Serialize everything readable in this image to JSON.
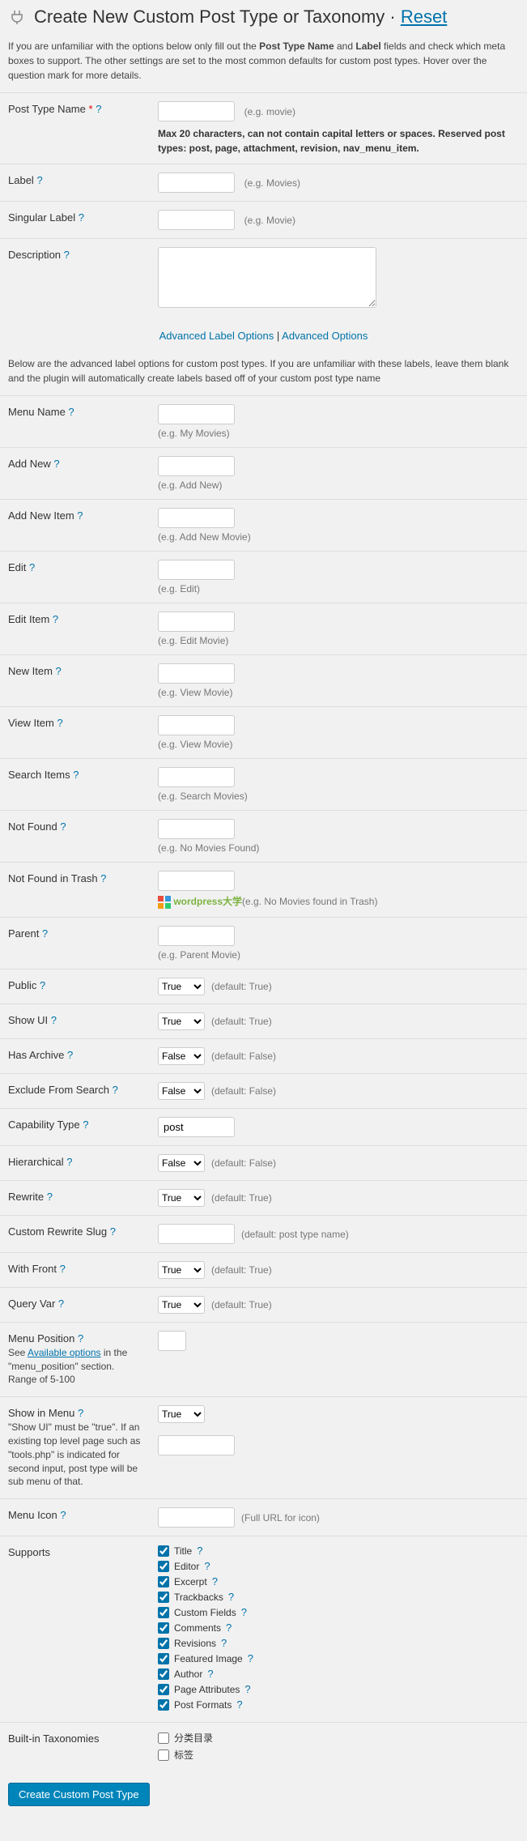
{
  "header": {
    "title": "Create New Custom Post Type or Taxonomy",
    "separator": " · ",
    "reset": "Reset"
  },
  "intro": {
    "prefix": "If you are unfamiliar with the options below only fill out the ",
    "b1": "Post Type Name",
    "mid": " and ",
    "b2": "Label",
    "suffix": " fields and check which meta boxes to support. The other settings are set to the most common defaults for custom post types. Hover over the question mark for more details."
  },
  "fields": {
    "post_type_name": {
      "label": "Post Type Name",
      "hint": "(e.g. movie)",
      "max_note": "Max 20 characters, can not contain capital letters or spaces. Reserved post types: post, page, attachment, revision, nav_menu_item."
    },
    "label": {
      "label": "Label",
      "hint": "(e.g. Movies)"
    },
    "singular_label": {
      "label": "Singular Label",
      "hint": "(e.g. Movie)"
    },
    "description": {
      "label": "Description"
    }
  },
  "adv_links": {
    "a1": "Advanced Label Options",
    "sep": " | ",
    "a2": "Advanced Options"
  },
  "adv_note": "Below are the advanced label options for custom post types. If you are unfamiliar with these labels, leave them blank and the plugin will automatically create labels based off of your custom post type name",
  "adv_labels": [
    {
      "key": "menu_name",
      "label": "Menu Name",
      "hint": "(e.g. My Movies)"
    },
    {
      "key": "add_new",
      "label": "Add New",
      "hint": "(e.g. Add New)"
    },
    {
      "key": "add_new_item",
      "label": "Add New Item",
      "hint": "(e.g. Add New Movie)"
    },
    {
      "key": "edit",
      "label": "Edit",
      "hint": "(e.g. Edit)"
    },
    {
      "key": "edit_item",
      "label": "Edit Item",
      "hint": "(e.g. Edit Movie)"
    },
    {
      "key": "new_item",
      "label": "New Item",
      "hint": "(e.g. View Movie)"
    },
    {
      "key": "view_item",
      "label": "View Item",
      "hint": "(e.g. View Movie)"
    },
    {
      "key": "search_items",
      "label": "Search Items",
      "hint": "(e.g. Search Movies)"
    },
    {
      "key": "not_found",
      "label": "Not Found",
      "hint": "(e.g. No Movies Found)"
    },
    {
      "key": "not_found_trash",
      "label": "Not Found in Trash",
      "hint": "(e.g. No Movies found in Trash)",
      "watermark": true
    },
    {
      "key": "parent",
      "label": "Parent",
      "hint": "(e.g. Parent Movie)"
    }
  ],
  "opts": {
    "public": {
      "label": "Public",
      "value": "True",
      "default": "(default: True)"
    },
    "show_ui": {
      "label": "Show UI",
      "value": "True",
      "default": "(default: True)"
    },
    "has_archive": {
      "label": "Has Archive",
      "value": "False",
      "default": "(default: False)"
    },
    "exclude_search": {
      "label": "Exclude From Search",
      "value": "False",
      "default": "(default: False)"
    },
    "capability_type": {
      "label": "Capability Type",
      "value": "post"
    },
    "hierarchical": {
      "label": "Hierarchical",
      "value": "False",
      "default": "(default: False)"
    },
    "rewrite": {
      "label": "Rewrite",
      "value": "True",
      "default": "(default: True)"
    },
    "custom_rewrite": {
      "label": "Custom Rewrite Slug",
      "default": "(default: post type name)"
    },
    "with_front": {
      "label": "With Front",
      "value": "True",
      "default": "(default: True)"
    },
    "query_var": {
      "label": "Query Var",
      "value": "True",
      "default": "(default: True)"
    },
    "menu_position": {
      "label": "Menu Position",
      "sub_pre": "See ",
      "sub_link": "Available options",
      "sub_post": " in the \"menu_position\" section. Range of 5-100"
    },
    "show_in_menu": {
      "label": "Show in Menu",
      "value": "True",
      "sub": "\"Show UI\" must be \"true\". If an existing top level page such as \"tools.php\" is indicated for second input, post type will be sub menu of that."
    },
    "menu_icon": {
      "label": "Menu Icon",
      "hint": "(Full URL for icon)"
    }
  },
  "supports": {
    "label": "Supports",
    "items": [
      {
        "name": "title",
        "label": "Title",
        "checked": true
      },
      {
        "name": "editor",
        "label": "Editor",
        "checked": true
      },
      {
        "name": "excerpt",
        "label": "Excerpt",
        "checked": true
      },
      {
        "name": "trackbacks",
        "label": "Trackbacks",
        "checked": true
      },
      {
        "name": "custom_fields",
        "label": "Custom Fields",
        "checked": true
      },
      {
        "name": "comments",
        "label": "Comments",
        "checked": true
      },
      {
        "name": "revisions",
        "label": "Revisions",
        "checked": true
      },
      {
        "name": "featured_image",
        "label": "Featured Image",
        "checked": true
      },
      {
        "name": "author",
        "label": "Author",
        "checked": true
      },
      {
        "name": "page_attributes",
        "label": "Page Attributes",
        "checked": true
      },
      {
        "name": "post_formats",
        "label": "Post Formats",
        "checked": true
      }
    ]
  },
  "taxonomies": {
    "label": "Built-in Taxonomies",
    "items": [
      {
        "name": "categories",
        "label": "分类目录",
        "checked": false
      },
      {
        "name": "tags",
        "label": "标签",
        "checked": false
      }
    ]
  },
  "submit": "Create Custom Post Type",
  "help_q": "?",
  "watermark": "wordpress大学"
}
